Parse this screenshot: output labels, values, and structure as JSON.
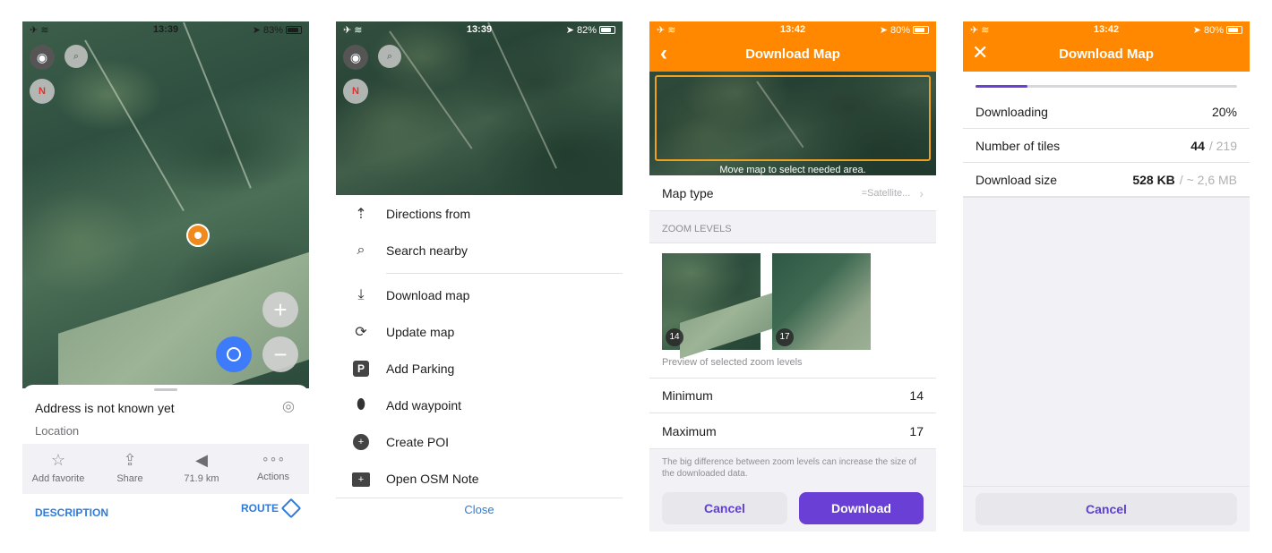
{
  "screen1": {
    "status": {
      "time": "13:39",
      "battery": "83%",
      "battery_fraction": 0.83
    },
    "sheet": {
      "address": "Address is not known yet",
      "subtitle": "Location",
      "actions": [
        {
          "icon": "star-icon",
          "label": "Add favorite"
        },
        {
          "icon": "share-icon",
          "label": "Share"
        },
        {
          "icon": "direction-icon",
          "label": "71.9 km"
        },
        {
          "icon": "more-icon",
          "label": "Actions"
        }
      ],
      "description": "DESCRIPTION",
      "route": "ROUTE"
    }
  },
  "screen2": {
    "status": {
      "time": "13:39",
      "battery": "82%",
      "battery_fraction": 0.82
    },
    "menu": [
      {
        "icon": "directions-icon",
        "label": "Directions from"
      },
      {
        "icon": "search-icon",
        "label": "Search nearby"
      },
      {
        "icon": "download-icon",
        "label": "Download map"
      },
      {
        "icon": "update-icon",
        "label": "Update map"
      },
      {
        "icon": "parking-icon",
        "label": "Add Parking"
      },
      {
        "icon": "waypoint-icon",
        "label": "Add waypoint"
      },
      {
        "icon": "poi-icon",
        "label": "Create POI"
      },
      {
        "icon": "note-icon",
        "label": "Open OSM Note"
      }
    ],
    "close": "Close"
  },
  "screen3": {
    "status": {
      "time": "13:42",
      "battery": "80%",
      "battery_fraction": 0.8
    },
    "title": "Download Map",
    "map_hint": "Move map to select needed area.",
    "map_type_label": "Map type",
    "map_type_value": "=Satellite...",
    "zoom_header": "ZOOM LEVELS",
    "preview_labels": [
      "14",
      "17"
    ],
    "preview_caption": "Preview of selected zoom levels",
    "minimum_label": "Minimum",
    "minimum_value": "14",
    "maximum_label": "Maximum",
    "maximum_value": "17",
    "note": "The big difference between zoom levels can increase the size of the downloaded data.",
    "cancel": "Cancel",
    "download": "Download"
  },
  "screen4": {
    "status": {
      "time": "13:42",
      "battery": "80%",
      "battery_fraction": 0.8
    },
    "title": "Download Map",
    "progress": 0.2,
    "downloading_label": "Downloading",
    "downloading_value": "20%",
    "tiles_label": "Number of tiles",
    "tiles_value": "44",
    "tiles_total": "/ 219",
    "size_label": "Download size",
    "size_value": "528 KB",
    "size_total": "/ ~ 2,6 MB",
    "cancel": "Cancel"
  },
  "colors": {
    "orange": "#ff8800",
    "purple": "#6a3fd6",
    "blue": "#3e7bfa",
    "link": "#2f7bd9"
  }
}
